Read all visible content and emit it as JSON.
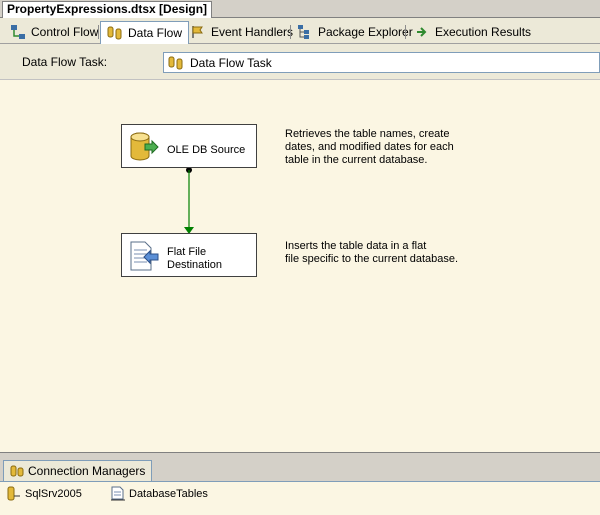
{
  "document": {
    "title": "PropertyExpressions.dtsx [Design]"
  },
  "designer_tabs": [
    {
      "label": "Control Flow",
      "icon": "control-flow-icon",
      "active": false
    },
    {
      "label": "Data Flow",
      "icon": "data-flow-icon",
      "active": true
    },
    {
      "label": "Event Handlers",
      "icon": "event-handlers-icon",
      "active": false
    },
    {
      "label": "Package Explorer",
      "icon": "package-explorer-icon",
      "active": false
    },
    {
      "label": "Execution Results",
      "icon": "execution-results-icon",
      "active": false
    }
  ],
  "task_selector": {
    "label": "Data Flow Task:",
    "value": "Data Flow Task"
  },
  "components": [
    {
      "label": "OLE DB Source",
      "icon": "database-source-icon",
      "annotation": "Retrieves the table names, create\ndates, and modified dates for each\ntable in the current database."
    },
    {
      "label": "Flat File\nDestination",
      "icon": "flat-file-icon",
      "annotation": "Inserts the table data in a flat\nfile specific to the current database."
    }
  ],
  "connection_managers": {
    "tab_label": "Connection Managers",
    "items": [
      {
        "label": "SqlSrv2005",
        "icon": "ole-db-connection-icon"
      },
      {
        "label": "DatabaseTables",
        "icon": "flat-file-connection-icon"
      }
    ]
  },
  "colors": {
    "design_surface": "#fbf6e3",
    "connector": "#008000",
    "chrome": "#d4d0c8",
    "tab_bar": "#ece9d8"
  }
}
